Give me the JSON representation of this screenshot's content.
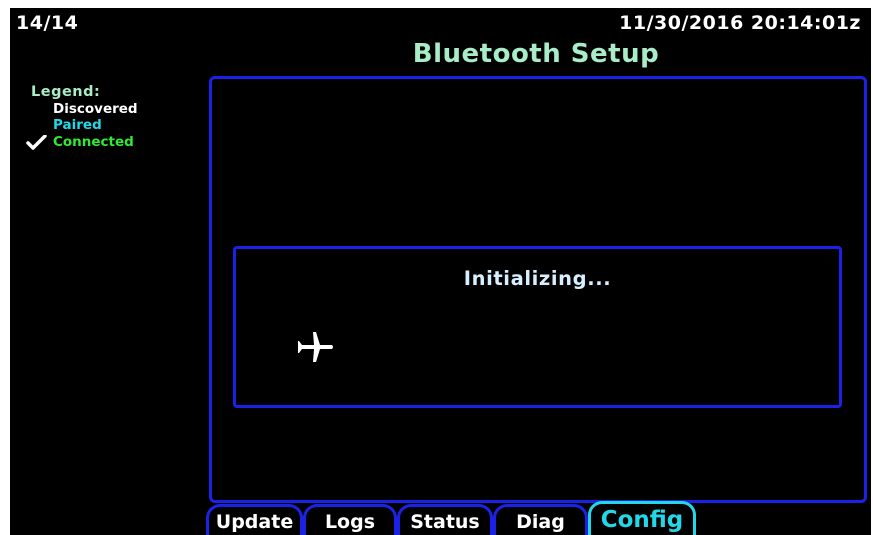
{
  "header": {
    "page_counter": "14/14",
    "datetime": "11/30/2016 20:14:01z",
    "title": "Bluetooth Setup"
  },
  "legend": {
    "title": "Legend:",
    "discovered": "Discovered",
    "paired": "Paired",
    "connected": "Connected",
    "connected_icon": "checkmark-icon"
  },
  "dialog": {
    "message": "Initializing...",
    "icon": "airplane-icon"
  },
  "tabs": [
    {
      "label": "Update"
    },
    {
      "label": "Logs"
    },
    {
      "label": "Status"
    },
    {
      "label": "Diag"
    },
    {
      "label": "Config",
      "active": true
    }
  ],
  "colors": {
    "background": "#000000",
    "border_blue": "#1b22e6",
    "title_green": "#a8ecc8",
    "paired_cyan": "#22d8e8",
    "connected_green": "#33e833",
    "active_tab": "#22d8e8"
  }
}
